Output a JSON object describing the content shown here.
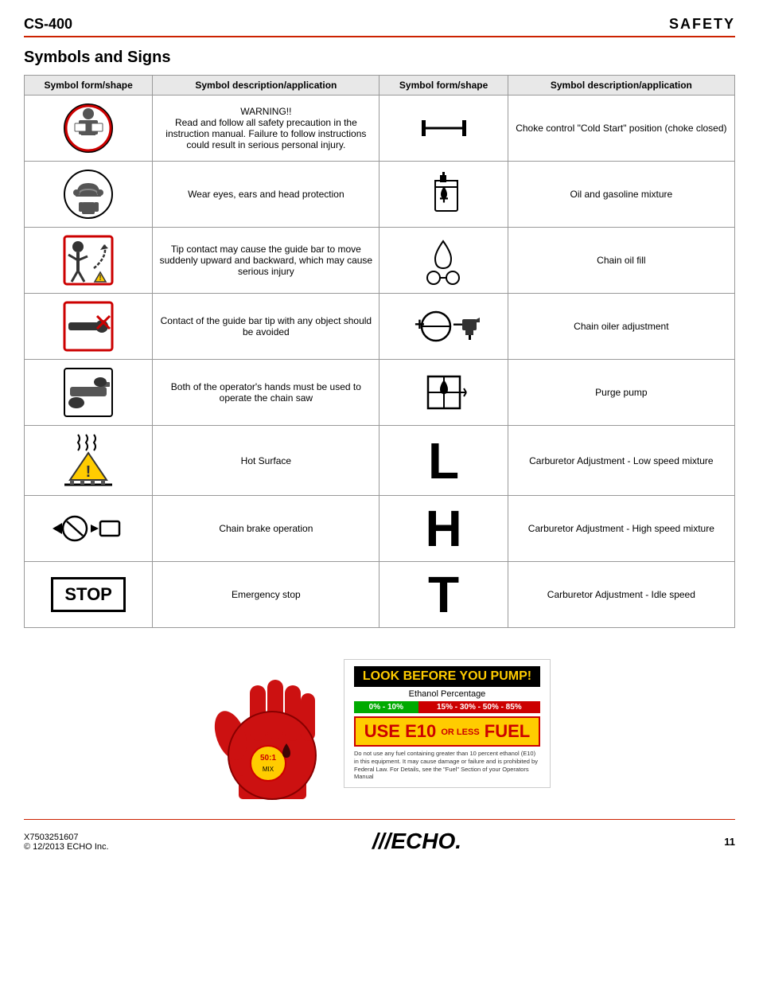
{
  "header": {
    "left": "CS-400",
    "right": "SAFETY"
  },
  "section_title": "Symbols and Signs",
  "table": {
    "col_headers": [
      "Symbol form/shape",
      "Symbol description/application",
      "Symbol form/shape",
      "Symbol description/application"
    ],
    "rows": [
      {
        "sym1": "warning-icon",
        "desc1": "WARNING!!\nRead and follow all safety precaution in the instruction manual. Failure to follow instructions could result in serious personal injury.",
        "sym2": "choke-icon",
        "desc2": "Choke control \"Cold Start\" position (choke closed)"
      },
      {
        "sym1": "ppe-icon",
        "desc1": "Wear eyes, ears and head protection",
        "sym2": "oil-gas-icon",
        "desc2": "Oil and gasoline mixture"
      },
      {
        "sym1": "kickback-icon",
        "desc1": "Tip contact may cause the guide bar to move suddenly upward and backward, which may cause serious injury",
        "sym2": "chain-oil-fill-icon",
        "desc2": "Chain oil fill"
      },
      {
        "sym1": "guide-bar-icon",
        "desc1": "Contact of the guide bar tip with any object should be avoided",
        "sym2": "chain-oiler-icon",
        "desc2": "Chain oiler adjustment"
      },
      {
        "sym1": "two-hands-icon",
        "desc1": "Both of the operator's hands must be used to operate the chain saw",
        "sym2": "purge-pump-icon",
        "desc2": "Purge pump"
      },
      {
        "sym1": "hot-surface-icon",
        "desc1": "Hot Surface",
        "sym2": "letter-L",
        "desc2": "Carburetor Adjustment - Low speed mixture"
      },
      {
        "sym1": "chain-brake-icon",
        "desc1": "Chain brake operation",
        "sym2": "letter-H",
        "desc2": "Carburetor Adjustment - High speed mixture"
      },
      {
        "sym1": "stop-icon",
        "desc1": "Emergency stop",
        "sym2": "letter-T",
        "desc2": "Carburetor Adjustment - Idle speed"
      }
    ]
  },
  "pump_sign": {
    "title_black": "LOOK BEFORE YOU",
    "title_yellow": "PUMP!",
    "ethanol_label": "Ethanol Percentage",
    "green_range": "0% - 10%",
    "red_range": "15% - 30% - 50% - 85%",
    "use_label": "USE E10",
    "or_less": "OR LESS",
    "fuel": "FUEL",
    "disclaimer": "Do not use any fuel containing greater than 10 percent ethanol (E10) in this equipment. It may cause damage or failure and is prohibited by Federal Law. For Details, see the \"Fuel\" Section of your Operators Manual"
  },
  "footer": {
    "part_number": "X7503251607",
    "copyright": "© 12/2013 ECHO Inc.",
    "page_number": "11"
  }
}
